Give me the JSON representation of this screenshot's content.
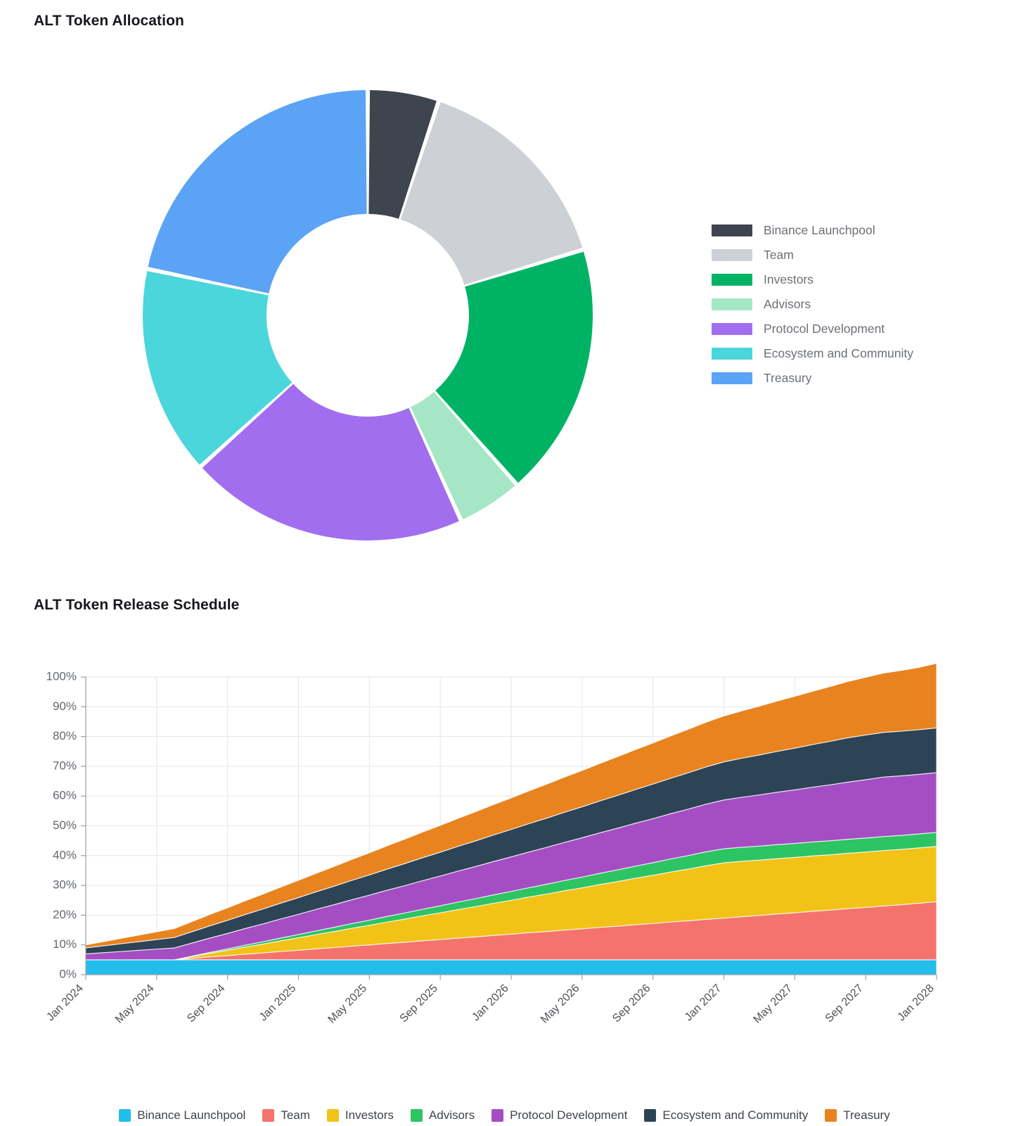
{
  "allocation": {
    "title": "ALT Token Allocation",
    "legend": [
      {
        "label": "Binance Launchpool",
        "color": "#3f454f"
      },
      {
        "label": "Team",
        "color": "#cdd0d4"
      },
      {
        "label": "Investors",
        "color": "#00b364"
      },
      {
        "label": "Advisors",
        "color": "#a5e6c6"
      },
      {
        "label": "Protocol Development",
        "color": "#a濃"
      },
      {
        "label": "Ecosystem and Community",
        "color": "#4ad6da"
      },
      {
        "label": "Treasury",
        "color": "#5ba3f5"
      }
    ]
  },
  "chart_data": [
    {
      "type": "pie",
      "variant": "donut",
      "title": "ALT Token Allocation",
      "legend_position": "right",
      "start_angle_deg": 0,
      "direction": "clockwise",
      "inner_radius_ratio": 0.45,
      "labels": [
        "Binance Launchpool",
        "Team",
        "Investors",
        "Advisors",
        "Protocol Development",
        "Ecosystem and Community",
        "Treasury"
      ],
      "values": [
        5.1,
        15.2,
        18.2,
        4.7,
        20.1,
        15.0,
        21.7
      ],
      "unit": "%",
      "colors": [
        "#3f454f",
        "#cdd0d4",
        "#00b364",
        "#a5e6c6",
        "#a16ef0",
        "#4ad6da",
        "#5ba3f5"
      ]
    },
    {
      "type": "area",
      "stacked": true,
      "title": "ALT Token Release Schedule",
      "xlabel": "",
      "ylabel": "",
      "ylim": [
        0,
        100
      ],
      "yticks": [
        0,
        10,
        20,
        30,
        40,
        50,
        60,
        70,
        80,
        90,
        100
      ],
      "ytick_labels": [
        "0%",
        "10%",
        "20%",
        "30%",
        "40%",
        "50%",
        "60%",
        "70%",
        "80%",
        "90%",
        "100%"
      ],
      "grid": true,
      "legend_position": "bottom",
      "x": [
        "Jan 2024",
        "Feb 2024",
        "Mar 2024",
        "Apr 2024",
        "May 2024",
        "Jun 2024",
        "Jul 2024",
        "Aug 2024",
        "Sep 2024",
        "Oct 2024",
        "Nov 2024",
        "Dec 2024",
        "Jan 2025",
        "Feb 2025",
        "Mar 2025",
        "Apr 2025",
        "May 2025",
        "Jun 2025",
        "Jul 2025",
        "Aug 2025",
        "Sep 2025",
        "Oct 2025",
        "Nov 2025",
        "Dec 2025",
        "Jan 2026",
        "Feb 2026",
        "Mar 2026",
        "Apr 2026",
        "May 2026",
        "Jun 2026",
        "Jul 2026",
        "Aug 2026",
        "Sep 2026",
        "Oct 2026",
        "Nov 2026",
        "Dec 2026",
        "Jan 2027",
        "Feb 2027",
        "Mar 2027",
        "Apr 2027",
        "May 2027",
        "Jun 2027",
        "Jul 2027",
        "Aug 2027",
        "Sep 2027",
        "Oct 2027",
        "Nov 2027",
        "Dec 2027",
        "Jan 2028"
      ],
      "xtick_labels": [
        "Jan 2024",
        "May 2024",
        "Sep 2024",
        "Jan 2025",
        "May 2025",
        "Sep 2025",
        "Jan 2026",
        "May 2026",
        "Sep 2026",
        "Jan 2027",
        "May 2027",
        "Sep 2027",
        "Jan 2028"
      ],
      "xtick_indices": [
        0,
        4,
        8,
        12,
        16,
        20,
        24,
        28,
        32,
        36,
        40,
        44,
        48
      ],
      "series": [
        {
          "name": "Binance Launchpool",
          "color": "#22bdeb",
          "values": [
            5.0,
            5.0,
            5.0,
            5.0,
            5.0,
            5.0,
            5.0,
            5.0,
            5.0,
            5.0,
            5.0,
            5.0,
            5.0,
            5.0,
            5.0,
            5.0,
            5.0,
            5.0,
            5.0,
            5.0,
            5.0,
            5.0,
            5.0,
            5.0,
            5.0,
            5.0,
            5.0,
            5.0,
            5.0,
            5.0,
            5.0,
            5.0,
            5.0,
            5.0,
            5.0,
            5.0,
            5.0,
            5.0,
            5.0,
            5.0,
            5.0,
            5.0,
            5.0,
            5.0,
            5.0,
            5.0,
            5.0,
            5.0,
            5.0
          ]
        },
        {
          "name": "Team",
          "color": "#f4736d",
          "values": [
            0,
            0,
            0,
            0,
            0,
            0,
            0.5,
            1.0,
            1.4,
            1.9,
            2.3,
            2.8,
            3.2,
            3.7,
            4.1,
            4.6,
            5.0,
            5.5,
            5.9,
            6.4,
            6.8,
            7.3,
            7.7,
            8.2,
            8.6,
            9.1,
            9.5,
            10.0,
            10.4,
            10.9,
            11.3,
            11.8,
            12.2,
            12.7,
            13.1,
            13.6,
            14.0,
            14.5,
            14.9,
            15.4,
            15.8,
            16.3,
            16.7,
            17.2,
            17.6,
            18.1,
            18.5,
            19.0,
            19.5
          ]
        },
        {
          "name": "Investors",
          "color": "#f2c316",
          "values": [
            0,
            0,
            0,
            0,
            0,
            0,
            0.6,
            1.2,
            1.8,
            2.4,
            3.0,
            3.6,
            4.2,
            4.8,
            5.4,
            6.0,
            6.6,
            7.2,
            7.8,
            8.4,
            9.0,
            9.6,
            10.2,
            10.8,
            11.4,
            12.0,
            12.6,
            13.2,
            13.8,
            14.4,
            15.0,
            15.6,
            16.2,
            16.8,
            17.4,
            18.0,
            18.6,
            18.6,
            18.6,
            18.6,
            18.6,
            18.6,
            18.6,
            18.6,
            18.6,
            18.6,
            18.6,
            18.6,
            18.6
          ]
        },
        {
          "name": "Advisors",
          "color": "#2dc463",
          "values": [
            0,
            0,
            0,
            0,
            0,
            0,
            0.16,
            0.31,
            0.47,
            0.63,
            0.78,
            0.94,
            1.1,
            1.25,
            1.41,
            1.57,
            1.72,
            1.88,
            2.04,
            2.19,
            2.35,
            2.51,
            2.66,
            2.82,
            2.98,
            3.13,
            3.29,
            3.45,
            3.6,
            3.76,
            3.92,
            4.07,
            4.23,
            4.39,
            4.54,
            4.7,
            4.7,
            4.7,
            4.7,
            4.7,
            4.7,
            4.7,
            4.7,
            4.7,
            4.7,
            4.7,
            4.7,
            4.7,
            4.7
          ]
        },
        {
          "name": "Protocol Development",
          "color": "#a54ec4",
          "values": [
            2.0,
            2.4,
            2.8,
            3.2,
            3.6,
            4.0,
            4.4,
            4.8,
            5.2,
            5.6,
            6.0,
            6.4,
            6.8,
            7.2,
            7.6,
            8.0,
            8.4,
            8.8,
            9.2,
            9.6,
            10.0,
            10.4,
            10.8,
            11.2,
            11.6,
            12.0,
            12.4,
            12.8,
            13.2,
            13.6,
            14.0,
            14.4,
            14.8,
            15.2,
            15.6,
            16.0,
            16.4,
            16.8,
            17.2,
            17.6,
            18.0,
            18.4,
            18.8,
            19.2,
            19.6,
            20.0,
            20.0,
            20.0,
            20.1
          ]
        },
        {
          "name": "Ecosystem and Community",
          "color": "#2d4356",
          "values": [
            2.0,
            2.3,
            2.6,
            2.9,
            3.2,
            3.5,
            3.8,
            4.1,
            4.4,
            4.7,
            5.0,
            5.3,
            5.6,
            5.9,
            6.2,
            6.5,
            6.8,
            7.1,
            7.4,
            7.7,
            8.0,
            8.3,
            8.6,
            8.9,
            9.2,
            9.5,
            9.8,
            10.1,
            10.4,
            10.7,
            11.0,
            11.3,
            11.6,
            11.9,
            12.2,
            12.5,
            12.8,
            13.1,
            13.4,
            13.7,
            14.0,
            14.3,
            14.6,
            14.9,
            15.0,
            15.0,
            15.0,
            15.0,
            15.0
          ]
        },
        {
          "name": "Treasury",
          "color": "#e8831f",
          "values": [
            1.0,
            1.4,
            1.8,
            2.2,
            2.6,
            3.0,
            3.4,
            3.8,
            4.2,
            4.6,
            5.0,
            5.4,
            5.8,
            6.2,
            6.6,
            7.0,
            7.4,
            7.8,
            8.2,
            8.6,
            9.0,
            9.4,
            9.8,
            10.2,
            10.6,
            11.0,
            11.4,
            11.8,
            12.2,
            12.6,
            13.0,
            13.4,
            13.8,
            14.2,
            14.6,
            15.0,
            15.4,
            15.9,
            16.4,
            16.9,
            17.4,
            17.9,
            18.4,
            18.9,
            19.4,
            19.9,
            20.4,
            20.9,
            21.7
          ]
        }
      ]
    }
  ],
  "release": {
    "title": "ALT Token Release Schedule"
  }
}
